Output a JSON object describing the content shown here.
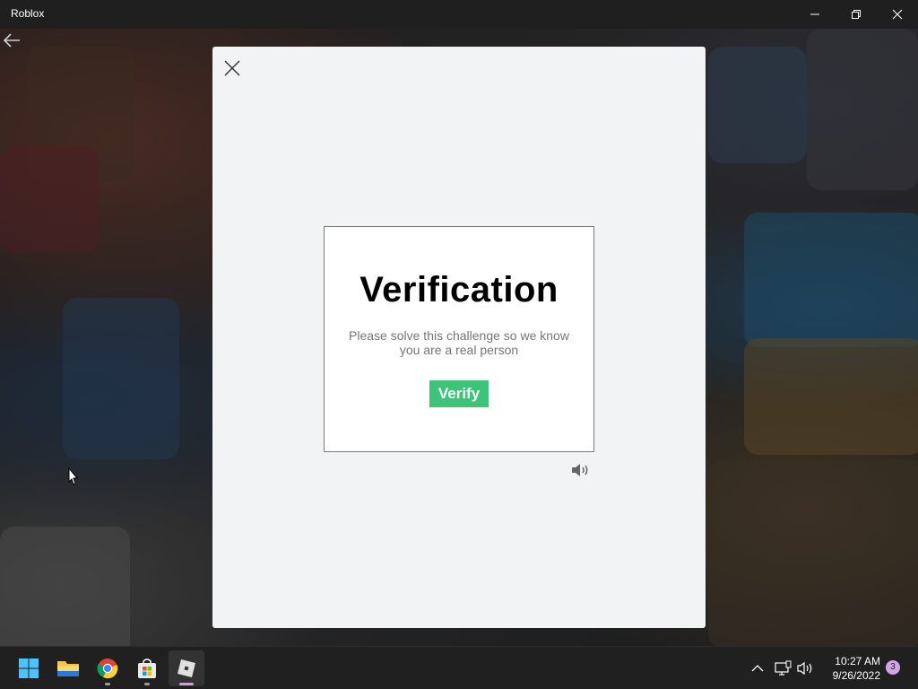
{
  "window": {
    "title": "Roblox"
  },
  "modal": {
    "challenge": {
      "title": "Verification",
      "message": "Please solve this challenge so we know you are a real person",
      "verify_label": "Verify"
    }
  },
  "taskbar": {
    "apps": [
      {
        "name": "Start",
        "icon": "windows-logo-icon"
      },
      {
        "name": "File Explorer",
        "icon": "folder-icon"
      },
      {
        "name": "Google Chrome",
        "icon": "chrome-icon"
      },
      {
        "name": "Microsoft Store",
        "icon": "store-icon"
      },
      {
        "name": "Roblox",
        "icon": "roblox-icon",
        "active": true
      }
    ],
    "clock": {
      "time": "10:27 AM",
      "date": "9/26/2022"
    },
    "notification_count": "3"
  },
  "colors": {
    "verify_button": "#3ec47a",
    "modal_background": "#f2f3f4",
    "titlebar": "#1f1f1f",
    "taskbar": "#202020"
  }
}
